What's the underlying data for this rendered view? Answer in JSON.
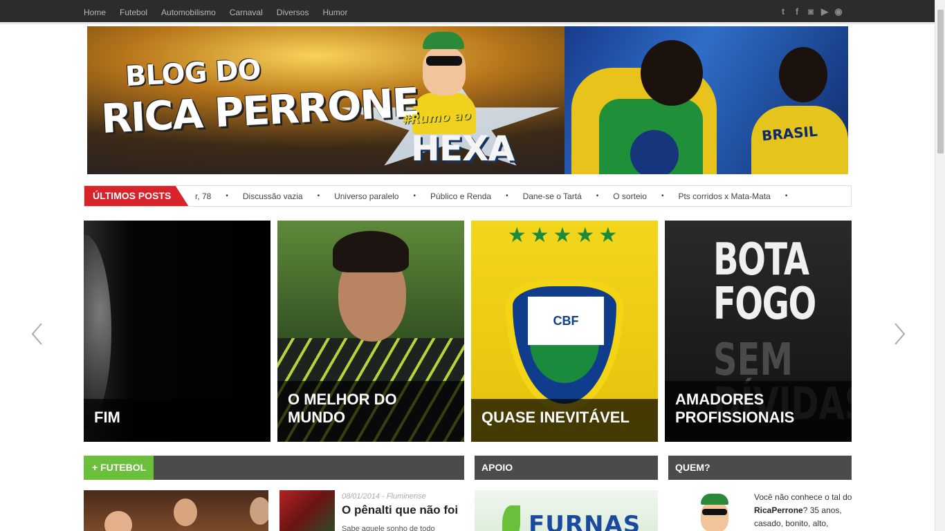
{
  "nav": {
    "items": [
      "Home",
      "Futebol",
      "Automobilismo",
      "Carnaval",
      "Diversos",
      "Humor"
    ]
  },
  "social": {
    "icons": [
      "twitter-icon",
      "facebook-icon",
      "instagram-icon",
      "youtube-icon",
      "rss-icon"
    ],
    "glyphs": [
      "t",
      "f",
      "◙",
      "▶",
      "◉"
    ]
  },
  "banner": {
    "title_line1": "BLOG DO",
    "title_line2": "RICA PERRONE",
    "tag": "#Rumo ao",
    "hexa": "HEXA",
    "shirt_text": "BRASIL"
  },
  "ticker": {
    "label": "ÚLTIMOS POSTS",
    "items": [
      "r, 78",
      "Discussão vazia",
      "Universo paralelo",
      "Público e Renda",
      "Dane-se o Tartá",
      "O sorteio",
      "Pts corridos x Mata-Mata"
    ],
    "separator": "•"
  },
  "slider": {
    "slides": [
      {
        "caption": "FIM"
      },
      {
        "caption": "O MELHOR DO MUNDO"
      },
      {
        "caption": "QUASE INEVITÁVEL",
        "badge_text": "CBF"
      },
      {
        "caption": "AMADORES PROFISSIONAIS",
        "image_text_top": "BOTA FOGO",
        "image_text_bottom": "SEM DÍVIDAS"
      }
    ]
  },
  "sections": {
    "futebol": "+ FUTEBOL",
    "apoio": "APOIO",
    "quem": "QUEM?"
  },
  "futebol_post": {
    "meta": "08/01/2014 - Fluminense",
    "title": "O pênalti que não foi",
    "excerpt": "Sabe aquele sonho de todo"
  },
  "apoio": {
    "sponsor": "FURNAS"
  },
  "quem": {
    "text_before": "Você não conhece o tal do ",
    "name": "RicaPerrone",
    "text_after": "? 35 anos, casado, bonito, alto,"
  }
}
